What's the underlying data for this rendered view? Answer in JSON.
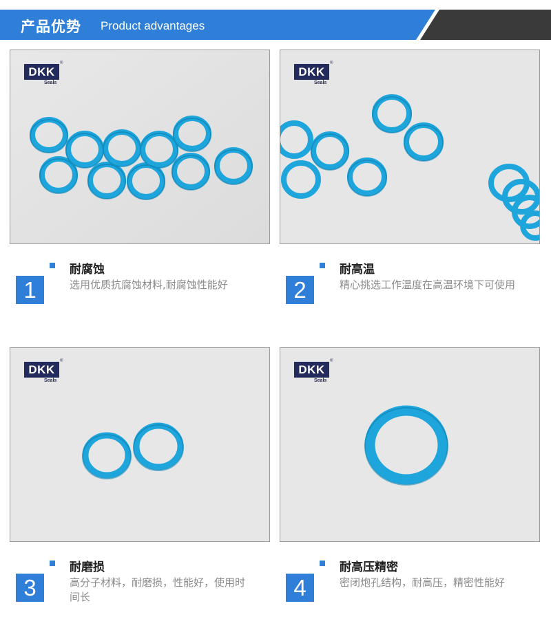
{
  "banner": {
    "title": "产品优势",
    "subtitle": "Product advantages",
    "colors": {
      "blue": "#2f7fd8",
      "dark": "#3a3a3a"
    }
  },
  "logo": {
    "brand": "DKK",
    "tag": "Seals",
    "reg": "®"
  },
  "panels": [
    {
      "image": "blue-o-rings-group"
    },
    {
      "image": "blue-o-rings-scattered"
    },
    {
      "image": "two-blue-o-rings"
    },
    {
      "image": "single-blue-o-ring"
    }
  ],
  "features": [
    {
      "number": "1",
      "title": "耐腐蚀",
      "desc": "选用优质抗腐蚀材料,耐腐蚀性能好"
    },
    {
      "number": "2",
      "title": "耐高温",
      "desc": "精心挑选工作温度在高温环境下可使用"
    },
    {
      "number": "3",
      "title": "耐磨损",
      "desc": "高分子材料，耐磨损，性能好，使用时间长"
    },
    {
      "number": "4",
      "title": "耐高压精密",
      "desc": "密闭炮孔结构，耐高压，精密性能好"
    }
  ],
  "accent_colors": {
    "ring": "#1ea6dc",
    "ring_dark": "#0d7fb0",
    "background": "#e4e4e4"
  }
}
